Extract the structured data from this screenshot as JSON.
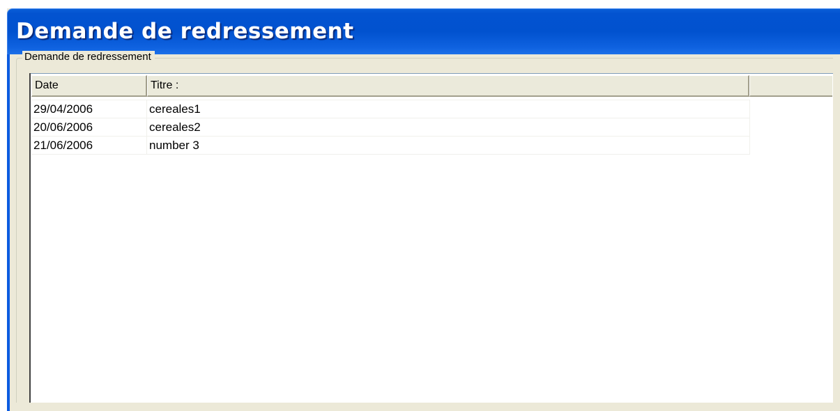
{
  "window": {
    "title": "Demande de redressement"
  },
  "group": {
    "label": "Demande de redressement"
  },
  "table": {
    "columns": [
      "Date",
      "Titre :"
    ],
    "rows": [
      {
        "date": "29/04/2006",
        "title": "cereales1"
      },
      {
        "date": "20/06/2006",
        "title": "cereales2"
      },
      {
        "date": "21/06/2006",
        "title": "number 3"
      }
    ]
  }
}
